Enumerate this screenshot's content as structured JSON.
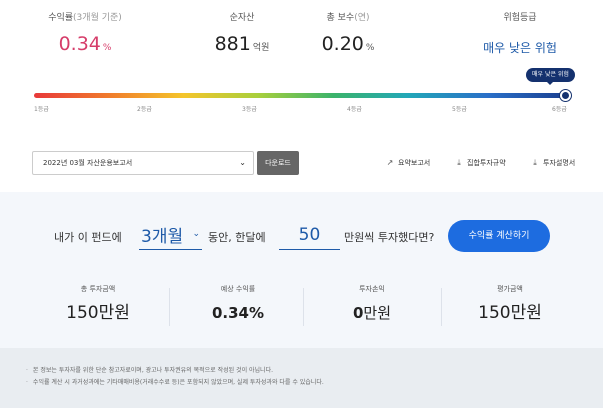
{
  "stats": {
    "return": {
      "label": "수익률",
      "sublabel": "(3개월 기준)",
      "value": "0.34",
      "unit": "%"
    },
    "assets": {
      "label": "순자산",
      "value": "881",
      "unit": "억원"
    },
    "fee": {
      "label": "총 보수",
      "sublabel": "(연)",
      "value": "0.20",
      "unit": "%"
    },
    "risk": {
      "label": "위험등급",
      "value": "매우 낮은 위험"
    }
  },
  "risk_bar": {
    "tooltip": "매우 낮은 위험",
    "ticks": [
      "1등급",
      "2등급",
      "3등급",
      "4등급",
      "5등급",
      "6등급"
    ],
    "current_grade": 6,
    "colors": {
      "marker": "#14316e"
    }
  },
  "report": {
    "selected": "2022년 03월 자산운용보고서",
    "download_label": "다운로드",
    "links": [
      {
        "label": "요약보고서",
        "icon": "external-link-icon"
      },
      {
        "label": "집합투자규약",
        "icon": "download-icon"
      },
      {
        "label": "투자설명서",
        "icon": "download-icon"
      }
    ]
  },
  "simulator": {
    "text_1": "내가 이 펀드에",
    "period": "3개월",
    "text_2": "동안, 한달에",
    "amount": "50",
    "text_3": "만원씩 투자했다면?",
    "button": "수익률 계산하기",
    "results": [
      {
        "label": "총 투자금액",
        "value": "150",
        "unit": "만원"
      },
      {
        "label": "예상 수익률",
        "value": "0.34%",
        "unit": ""
      },
      {
        "label": "투자손익",
        "value": "0",
        "unit": "만원"
      },
      {
        "label": "평가금액",
        "value": "150",
        "unit": "만원"
      }
    ]
  },
  "notes": [
    "본 정보는 투자자를 위한 단순 참고자료이며, 광고나 투자권유의 목적으로 작성된 것이 아닙니다.",
    "수익률 계산 시 과거성과에는 기타매매비용(거래수수료 등)은 포함되지 않았으며, 실제 투자성과와 다를 수 있습니다."
  ],
  "colors": {
    "return": "#d63d6a",
    "accent": "#1d6ce0",
    "risk_text": "#1e5aa8"
  }
}
